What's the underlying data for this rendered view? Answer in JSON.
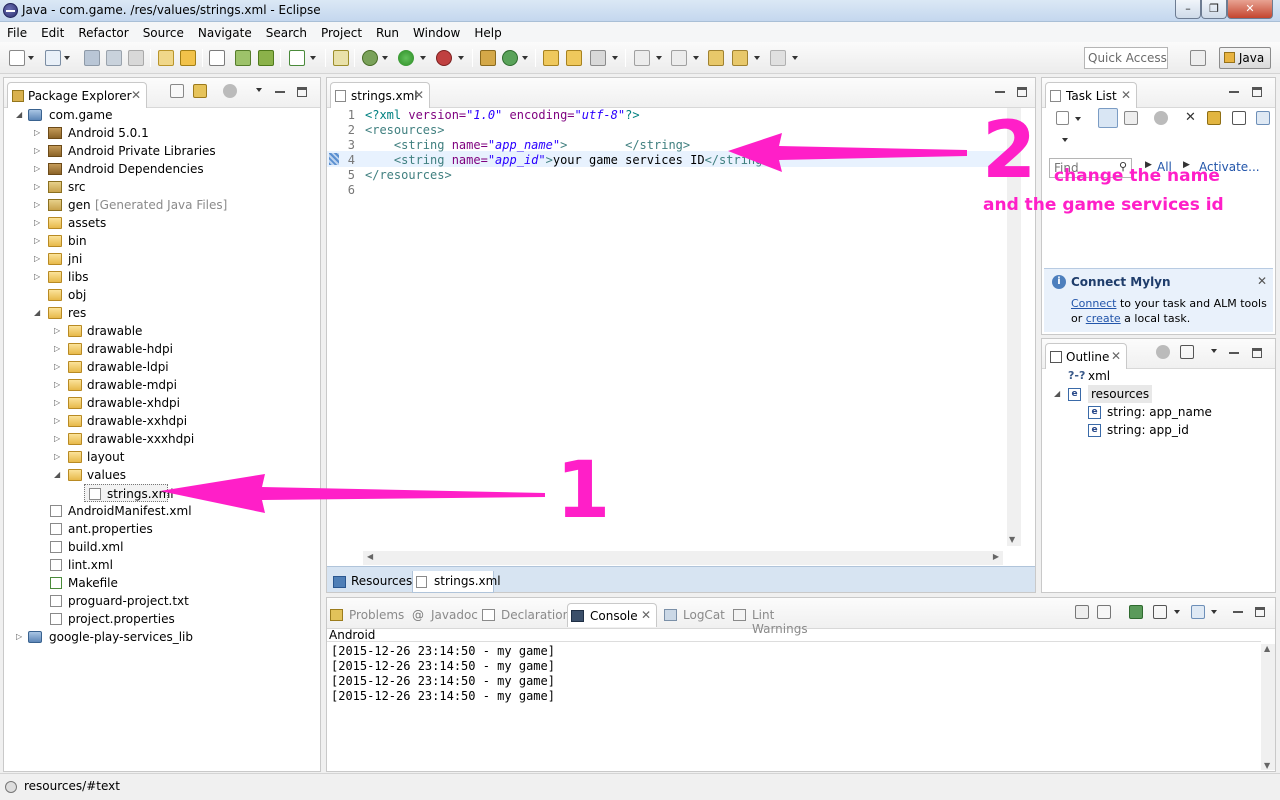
{
  "window": {
    "title": "Java - com.game.    /res/values/strings.xml - Eclipse"
  },
  "menu": [
    "File",
    "Edit",
    "Refactor",
    "Source",
    "Navigate",
    "Search",
    "Project",
    "Run",
    "Window",
    "Help"
  ],
  "toolbar": {
    "quick_access_placeholder": "Quick Access",
    "perspective": "Java"
  },
  "package_explorer": {
    "title": "Package Explorer",
    "project": "com.game",
    "items": [
      {
        "label": "Android 5.0.1"
      },
      {
        "label": "Android Private Libraries"
      },
      {
        "label": "Android Dependencies"
      },
      {
        "label": "src"
      },
      {
        "label": "gen",
        "suffix": "[Generated Java Files]"
      },
      {
        "label": "assets"
      },
      {
        "label": "bin"
      },
      {
        "label": "jni"
      },
      {
        "label": "libs"
      },
      {
        "label": "obj"
      },
      {
        "label": "res"
      }
    ],
    "res_items": [
      "drawable",
      "drawable-hdpi",
      "drawable-ldpi",
      "drawable-mdpi",
      "drawable-xhdpi",
      "drawable-xxhdpi",
      "drawable-xxxhdpi",
      "layout",
      "values"
    ],
    "values_file": "strings.xml",
    "root_files": [
      "AndroidManifest.xml",
      "ant.properties",
      "build.xml",
      "lint.xml",
      "Makefile",
      "proguard-project.txt",
      "project.properties"
    ],
    "other_project": "google-play-services_lib"
  },
  "editor": {
    "tab": "strings.xml",
    "line_numbers": [
      "1",
      "2",
      "3",
      "4",
      "5",
      "6"
    ],
    "lines": {
      "l1_a": "<?xml ",
      "l1_b": "version=",
      "l1_c": "\"1.0\"",
      "l1_d": " encoding=",
      "l1_e": "\"utf-8\"",
      "l1_f": "?>",
      "l2": "<resources>",
      "l3_a": "    <string ",
      "l3_b": "name=",
      "l3_c": "\"app_name\"",
      "l3_d": ">        ",
      "l3_e": "</string>",
      "l4_a": "    <string ",
      "l4_b": "name=",
      "l4_c": "\"app_id\"",
      "l4_d": ">",
      "l4_e": "your game services ID",
      "l4_f": "</string>",
      "l5": "</resources>"
    },
    "bottom_tabs": [
      "Resources",
      "strings.xml"
    ]
  },
  "task_list": {
    "title": "Task List",
    "find_placeholder": "Find",
    "all": "All",
    "activate": "Activate..."
  },
  "mylyn": {
    "title": "Connect Mylyn",
    "link1": "Connect",
    "text1": " to your task and ALM tools",
    "text2a": "or ",
    "link2": "create",
    "text2b": " a local task."
  },
  "outline": {
    "title": "Outline",
    "xml": "xml",
    "resources": "resources",
    "children": [
      "string: app_name",
      "string: app_id"
    ],
    "pi_icon": "?-?"
  },
  "console_panel": {
    "tabs": [
      "Problems",
      "Javadoc",
      "Declaration",
      "Console",
      "LogCat",
      "Lint Warnings"
    ],
    "active": "Console",
    "header": "Android",
    "lines": [
      "[2015-12-26 23:14:50 - my game]",
      "[2015-12-26 23:14:50 - my game]",
      "[2015-12-26 23:14:50 - my game]",
      "[2015-12-26 23:14:50 - my game]"
    ]
  },
  "annotations": {
    "num1": "1",
    "num2": "2",
    "text_line1": "change the name",
    "text_line2": "and the game services id",
    "color": "#ff1fc8"
  },
  "status": {
    "text": "resources/#text"
  }
}
